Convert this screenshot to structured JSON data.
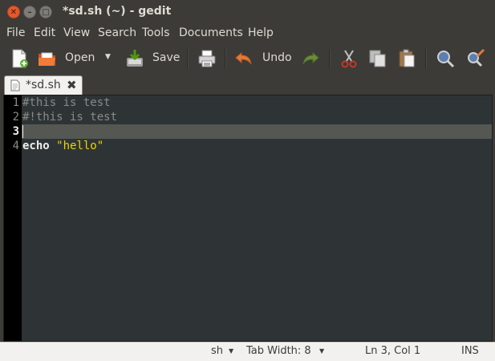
{
  "window": {
    "title": "*sd.sh (~) - gedit",
    "close_glyph": "✕",
    "minimize_glyph": "–",
    "maximize_glyph": "□"
  },
  "menubar": {
    "items": [
      "File",
      "Edit",
      "View",
      "Search",
      "Tools",
      "Documents",
      "Help"
    ]
  },
  "toolbar": {
    "open_label": "Open",
    "save_label": "Save",
    "undo_label": "Undo",
    "dropdown_glyph": "▼",
    "icons": [
      "new-document-icon",
      "open-folder-icon",
      "save-icon",
      "print-icon",
      "undo-icon",
      "redo-icon",
      "cut-icon",
      "copy-icon",
      "paste-icon",
      "search-icon",
      "replace-icon"
    ]
  },
  "tabs": [
    {
      "label": "*sd.sh",
      "close_glyph": "✖",
      "icon": "text-document-icon"
    }
  ],
  "editor": {
    "line_numbers": [
      "1",
      "2",
      "3",
      "4"
    ],
    "lines": [
      {
        "text": "#this is test",
        "style": "comment"
      },
      {
        "text": "#!this is test",
        "style": "comment"
      },
      {
        "text": "",
        "style": "plain"
      },
      {
        "keyword": "echo",
        "string": "\"hello\""
      }
    ],
    "current_line": 3,
    "colors": {
      "background": "#2e3436",
      "comment": "#888a85",
      "string": "#edd400",
      "current_line": "#555753"
    }
  },
  "statusbar": {
    "language": "sh",
    "tab_width": "Tab Width: 8",
    "position": "Ln 3, Col 1",
    "mode": "INS",
    "dropdown_glyph": "▼"
  }
}
